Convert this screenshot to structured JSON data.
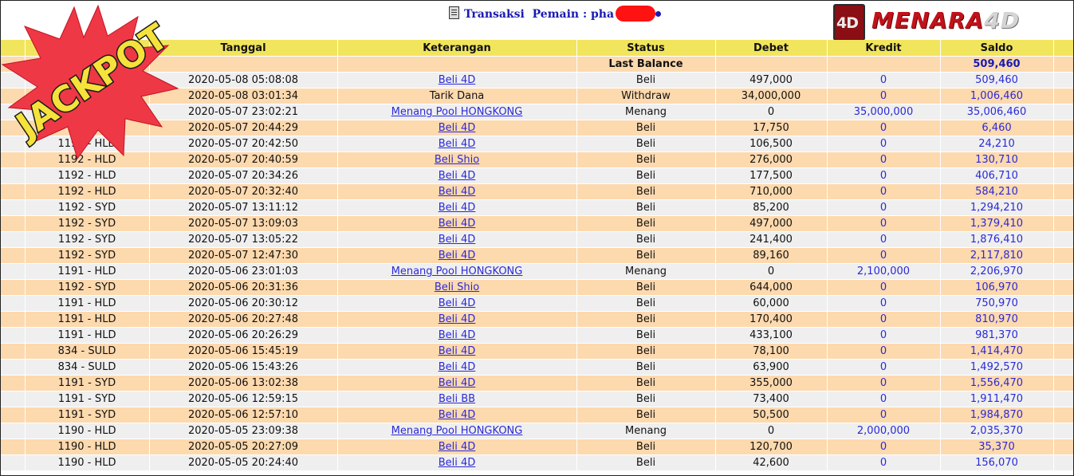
{
  "header": {
    "title_label": "Transaksi",
    "player_label": "Pemain : pha",
    "brand_main": "MENARA",
    "brand_suffix": "4D",
    "badge_text": "JACKPOT"
  },
  "columns": [
    "",
    "Tanggal",
    "Keterangan",
    "Status",
    "Debet",
    "Kredit",
    "Saldo",
    ""
  ],
  "last_balance": {
    "label": "Last Balance",
    "saldo": "509,460"
  },
  "rows": [
    {
      "id": "",
      "tanggal": "2020-05-08 05:08:08",
      "ket": "Beli 4D",
      "link": true,
      "status": "Beli",
      "debet": "497,000",
      "kredit": "0",
      "saldo": "509,460"
    },
    {
      "id": "",
      "tanggal": "2020-05-08 03:01:34",
      "ket": "Tarik Dana",
      "link": false,
      "status": "Withdraw",
      "debet": "34,000,000",
      "kredit": "0",
      "saldo": "1,006,460"
    },
    {
      "id": "",
      "tanggal": "2020-05-07 23:02:21",
      "ket": "Menang Pool HONGKONG",
      "link": true,
      "status": "Menang",
      "debet": "0",
      "kredit": "35,000,000",
      "saldo": "35,006,460"
    },
    {
      "id": "D",
      "tanggal": "2020-05-07 20:44:29",
      "ket": "Beli 4D",
      "link": true,
      "status": "Beli",
      "debet": "17,750",
      "kredit": "0",
      "saldo": "6,460"
    },
    {
      "id": "1192 - HLD",
      "tanggal": "2020-05-07 20:42:50",
      "ket": "Beli 4D",
      "link": true,
      "status": "Beli",
      "debet": "106,500",
      "kredit": "0",
      "saldo": "24,210"
    },
    {
      "id": "1192 - HLD",
      "tanggal": "2020-05-07 20:40:59",
      "ket": "Beli Shio",
      "link": true,
      "status": "Beli",
      "debet": "276,000",
      "kredit": "0",
      "saldo": "130,710"
    },
    {
      "id": "1192 - HLD",
      "tanggal": "2020-05-07 20:34:26",
      "ket": "Beli 4D",
      "link": true,
      "status": "Beli",
      "debet": "177,500",
      "kredit": "0",
      "saldo": "406,710"
    },
    {
      "id": "1192 - HLD",
      "tanggal": "2020-05-07 20:32:40",
      "ket": "Beli 4D",
      "link": true,
      "status": "Beli",
      "debet": "710,000",
      "kredit": "0",
      "saldo": "584,210"
    },
    {
      "id": "1192 - SYD",
      "tanggal": "2020-05-07 13:11:12",
      "ket": "Beli 4D",
      "link": true,
      "status": "Beli",
      "debet": "85,200",
      "kredit": "0",
      "saldo": "1,294,210"
    },
    {
      "id": "1192 - SYD",
      "tanggal": "2020-05-07 13:09:03",
      "ket": "Beli 4D",
      "link": true,
      "status": "Beli",
      "debet": "497,000",
      "kredit": "0",
      "saldo": "1,379,410"
    },
    {
      "id": "1192 - SYD",
      "tanggal": "2020-05-07 13:05:22",
      "ket": "Beli 4D",
      "link": true,
      "status": "Beli",
      "debet": "241,400",
      "kredit": "0",
      "saldo": "1,876,410"
    },
    {
      "id": "1192 - SYD",
      "tanggal": "2020-05-07 12:47:30",
      "ket": "Beli 4D",
      "link": true,
      "status": "Beli",
      "debet": "89,160",
      "kredit": "0",
      "saldo": "2,117,810"
    },
    {
      "id": "1191 - HLD",
      "tanggal": "2020-05-06 23:01:03",
      "ket": "Menang Pool HONGKONG",
      "link": true,
      "status": "Menang",
      "debet": "0",
      "kredit": "2,100,000",
      "saldo": "2,206,970"
    },
    {
      "id": "1192 - SYD",
      "tanggal": "2020-05-06 20:31:36",
      "ket": "Beli Shio",
      "link": true,
      "status": "Beli",
      "debet": "644,000",
      "kredit": "0",
      "saldo": "106,970"
    },
    {
      "id": "1191 - HLD",
      "tanggal": "2020-05-06 20:30:12",
      "ket": "Beli 4D",
      "link": true,
      "status": "Beli",
      "debet": "60,000",
      "kredit": "0",
      "saldo": "750,970"
    },
    {
      "id": "1191 - HLD",
      "tanggal": "2020-05-06 20:27:48",
      "ket": "Beli 4D",
      "link": true,
      "status": "Beli",
      "debet": "170,400",
      "kredit": "0",
      "saldo": "810,970"
    },
    {
      "id": "1191 - HLD",
      "tanggal": "2020-05-06 20:26:29",
      "ket": "Beli 4D",
      "link": true,
      "status": "Beli",
      "debet": "433,100",
      "kredit": "0",
      "saldo": "981,370"
    },
    {
      "id": "834 - SULD",
      "tanggal": "2020-05-06 15:45:19",
      "ket": "Beli 4D",
      "link": true,
      "status": "Beli",
      "debet": "78,100",
      "kredit": "0",
      "saldo": "1,414,470"
    },
    {
      "id": "834 - SULD",
      "tanggal": "2020-05-06 15:43:26",
      "ket": "Beli 4D",
      "link": true,
      "status": "Beli",
      "debet": "63,900",
      "kredit": "0",
      "saldo": "1,492,570"
    },
    {
      "id": "1191 - SYD",
      "tanggal": "2020-05-06 13:02:38",
      "ket": "Beli 4D",
      "link": true,
      "status": "Beli",
      "debet": "355,000",
      "kredit": "0",
      "saldo": "1,556,470"
    },
    {
      "id": "1191 - SYD",
      "tanggal": "2020-05-06 12:59:15",
      "ket": "Beli BB",
      "link": true,
      "status": "Beli",
      "debet": "73,400",
      "kredit": "0",
      "saldo": "1,911,470"
    },
    {
      "id": "1191 - SYD",
      "tanggal": "2020-05-06 12:57:10",
      "ket": "Beli 4D",
      "link": true,
      "status": "Beli",
      "debet": "50,500",
      "kredit": "0",
      "saldo": "1,984,870"
    },
    {
      "id": "1190 - HLD",
      "tanggal": "2020-05-05 23:09:38",
      "ket": "Menang Pool HONGKONG",
      "link": true,
      "status": "Menang",
      "debet": "0",
      "kredit": "2,000,000",
      "saldo": "2,035,370"
    },
    {
      "id": "1190 - HLD",
      "tanggal": "2020-05-05 20:27:09",
      "ket": "Beli 4D",
      "link": true,
      "status": "Beli",
      "debet": "120,700",
      "kredit": "0",
      "saldo": "35,370"
    },
    {
      "id": "1190 - HLD",
      "tanggal": "2020-05-05 20:24:40",
      "ket": "Beli 4D",
      "link": true,
      "status": "Beli",
      "debet": "42,600",
      "kredit": "0",
      "saldo": "156,070"
    }
  ],
  "colors": {
    "header_bg": "#f1e55d",
    "row_grey": "#efefef",
    "row_orange": "#fdd9ae",
    "link_blue": "#2a2ad8",
    "brand_red": "#c1121b",
    "redaction": "#ff1212"
  },
  "icons": {
    "title": "document-icon",
    "badge": "jackpot-starburst"
  }
}
